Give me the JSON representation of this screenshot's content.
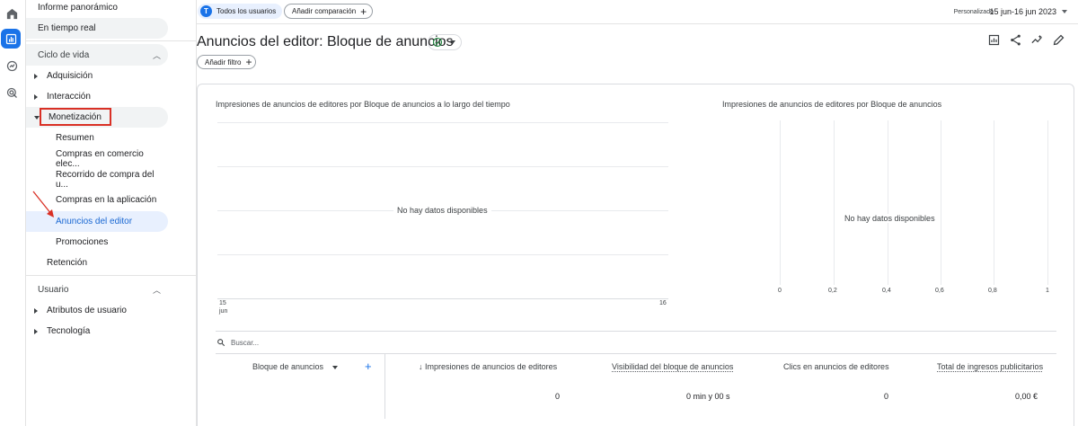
{
  "rail": {
    "icons": [
      "home-icon",
      "reports-icon",
      "explore-icon",
      "advertising-icon"
    ]
  },
  "sidebar": {
    "overview": "Informe panorámico",
    "realtime": "En tiempo real",
    "lifecycle_section": "Ciclo de vida",
    "acquisition": "Adquisición",
    "engagement": "Interacción",
    "monetization": "Monetización",
    "monetization_items": [
      "Resumen",
      "Compras en comercio elec...",
      "Recorrido de compra del u...",
      "Compras en la aplicación",
      "Anuncios del editor",
      "Promociones"
    ],
    "retention": "Retención",
    "user_section": "Usuario",
    "user_attributes": "Atributos de usuario",
    "technology": "Tecnología"
  },
  "topbar": {
    "users_avatar_letter": "T",
    "users_chip": "Todos los usuarios",
    "add_comparison": "Añadir comparación",
    "date_label": "Personalizado",
    "date_range": "15 jun-16 jun 2023"
  },
  "page": {
    "title": "Anuncios del editor: Bloque de anuncios",
    "add_filter": "Añadir filtro"
  },
  "chart_data": [
    {
      "type": "line",
      "title": "Impresiones de anuncios de editores por Bloque de anuncios a lo largo del tiempo",
      "x_ticks": [
        "15",
        "16"
      ],
      "x_tick_sub": "jun",
      "no_data": "No hay datos disponibles",
      "series": []
    },
    {
      "type": "bar",
      "title": "Impresiones de anuncios de editores por Bloque de anuncios",
      "x_ticks": [
        "0",
        "0,2",
        "0,4",
        "0,6",
        "0,8",
        "1"
      ],
      "no_data": "No hay datos disponibles",
      "series": []
    }
  ],
  "table": {
    "search_placeholder": "Buscar...",
    "dimension_header": "Bloque de anuncios",
    "columns": [
      "Impresiones de anuncios de editores",
      "Visibilidad del bloque de anuncios",
      "Clics en anuncios de editores",
      "Total de ingresos publicitarios"
    ],
    "totals": [
      "0",
      "0 min y 00 s",
      "0",
      "0,00 €"
    ]
  },
  "colors": {
    "accent": "#1a73e8",
    "highlight_border": "#d93025",
    "selected_bg": "#e8f0fe"
  }
}
